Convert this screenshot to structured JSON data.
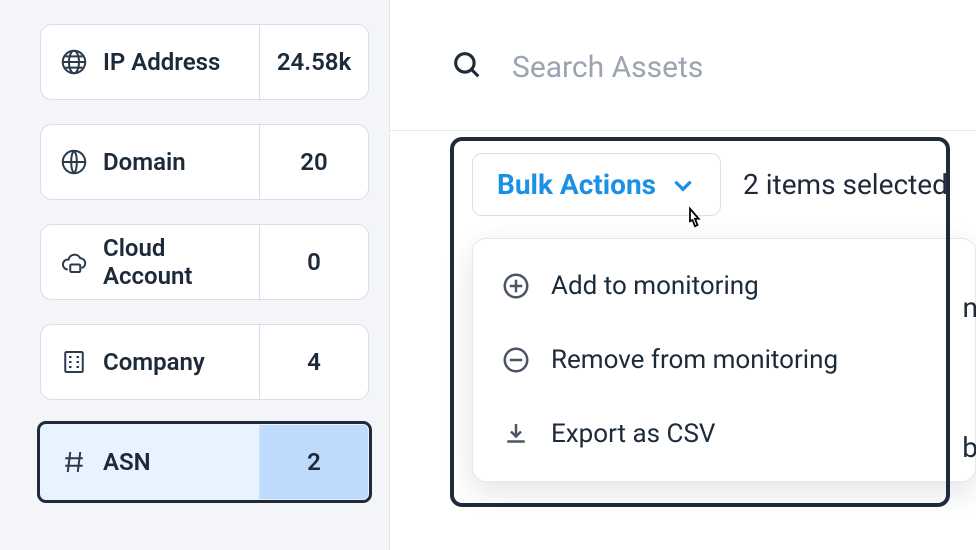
{
  "sidebar": {
    "items": [
      {
        "label": "IP Address",
        "count": "24.58k"
      },
      {
        "label": "Domain",
        "count": "20"
      },
      {
        "label": "Cloud Account",
        "count": "0"
      },
      {
        "label": "Company",
        "count": "4"
      },
      {
        "label": "ASN",
        "count": "2"
      }
    ]
  },
  "search": {
    "placeholder": "Search Assets"
  },
  "bulk": {
    "button_label": "Bulk Actions",
    "selected_text": "2 items selected",
    "menu": [
      {
        "label": "Add to monitoring"
      },
      {
        "label": "Remove from monitoring"
      },
      {
        "label": "Export as CSV"
      }
    ]
  },
  "edge_fragments": {
    "a": "n",
    "b": "b"
  }
}
